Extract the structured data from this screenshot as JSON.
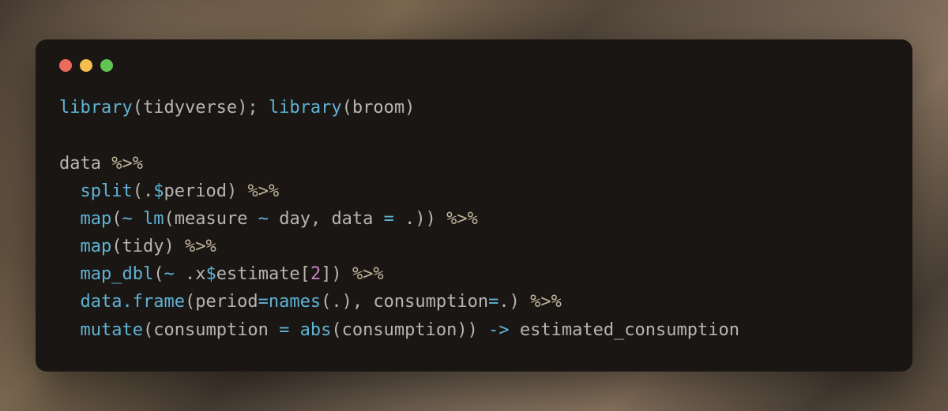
{
  "window": {
    "controls": [
      "close",
      "minimize",
      "maximize"
    ]
  },
  "code": {
    "tokens": [
      [
        {
          "t": "library",
          "c": "fn"
        },
        {
          "t": "(",
          "c": "ident"
        },
        {
          "t": "tidyverse",
          "c": "ident"
        },
        {
          "t": "); ",
          "c": "ident"
        },
        {
          "t": "library",
          "c": "fn"
        },
        {
          "t": "(",
          "c": "ident"
        },
        {
          "t": "broom",
          "c": "ident"
        },
        {
          "t": ")",
          "c": "ident"
        }
      ],
      [],
      [
        {
          "t": "data ",
          "c": "ident"
        },
        {
          "t": "%>%",
          "c": "pipe"
        }
      ],
      [
        {
          "t": "  ",
          "c": "ident"
        },
        {
          "t": "split",
          "c": "fn"
        },
        {
          "t": "(",
          "c": "ident"
        },
        {
          "t": ".",
          "c": "ident"
        },
        {
          "t": "$",
          "c": "op"
        },
        {
          "t": "period",
          "c": "ident"
        },
        {
          "t": ") ",
          "c": "ident"
        },
        {
          "t": "%>%",
          "c": "pipe"
        }
      ],
      [
        {
          "t": "  ",
          "c": "ident"
        },
        {
          "t": "map",
          "c": "fn"
        },
        {
          "t": "(",
          "c": "ident"
        },
        {
          "t": "~",
          "c": "op"
        },
        {
          "t": " ",
          "c": "ident"
        },
        {
          "t": "lm",
          "c": "fn"
        },
        {
          "t": "(measure ",
          "c": "ident"
        },
        {
          "t": "~",
          "c": "op"
        },
        {
          "t": " day, data ",
          "c": "ident"
        },
        {
          "t": "=",
          "c": "op"
        },
        {
          "t": " .)) ",
          "c": "ident"
        },
        {
          "t": "%>%",
          "c": "pipe"
        }
      ],
      [
        {
          "t": "  ",
          "c": "ident"
        },
        {
          "t": "map",
          "c": "fn"
        },
        {
          "t": "(tidy) ",
          "c": "ident"
        },
        {
          "t": "%>%",
          "c": "pipe"
        }
      ],
      [
        {
          "t": "  ",
          "c": "ident"
        },
        {
          "t": "map_dbl",
          "c": "fn"
        },
        {
          "t": "(",
          "c": "ident"
        },
        {
          "t": "~",
          "c": "op"
        },
        {
          "t": " .x",
          "c": "ident"
        },
        {
          "t": "$",
          "c": "op"
        },
        {
          "t": "estimate[",
          "c": "ident"
        },
        {
          "t": "2",
          "c": "num"
        },
        {
          "t": "]) ",
          "c": "ident"
        },
        {
          "t": "%>%",
          "c": "pipe"
        }
      ],
      [
        {
          "t": "  ",
          "c": "ident"
        },
        {
          "t": "data.frame",
          "c": "fn"
        },
        {
          "t": "(period",
          "c": "ident"
        },
        {
          "t": "=",
          "c": "op"
        },
        {
          "t": "names",
          "c": "fn"
        },
        {
          "t": "(.), consumption",
          "c": "ident"
        },
        {
          "t": "=",
          "c": "op"
        },
        {
          "t": ".) ",
          "c": "ident"
        },
        {
          "t": "%>%",
          "c": "pipe"
        }
      ],
      [
        {
          "t": "  ",
          "c": "ident"
        },
        {
          "t": "mutate",
          "c": "fn"
        },
        {
          "t": "(consumption ",
          "c": "ident"
        },
        {
          "t": "=",
          "c": "op"
        },
        {
          "t": " ",
          "c": "ident"
        },
        {
          "t": "abs",
          "c": "fn"
        },
        {
          "t": "(consumption)) ",
          "c": "ident"
        },
        {
          "t": "->",
          "c": "assign"
        },
        {
          "t": " estimated_consumption",
          "c": "ident"
        }
      ]
    ]
  }
}
